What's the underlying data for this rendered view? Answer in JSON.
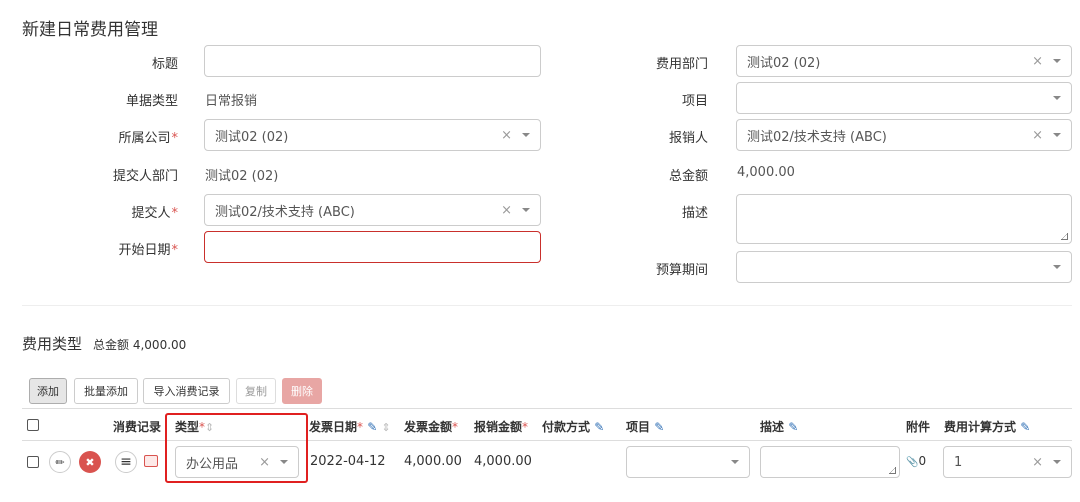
{
  "page": {
    "title": "新建日常费用管理"
  },
  "form": {
    "left": {
      "title_label": "标题",
      "title_value": "",
      "doc_type_label": "单据类型",
      "doc_type_value": "日常报销",
      "company_label": "所属公司",
      "company_value": "测试02 (02)",
      "submitter_dept_label": "提交人部门",
      "submitter_dept_value": "测试02 (02)",
      "submitter_label": "提交人",
      "submitter_value": "测试02/技术支持 (ABC)",
      "start_date_label": "开始日期",
      "start_date_value": ""
    },
    "right": {
      "cost_dept_label": "费用部门",
      "cost_dept_value": "测试02 (02)",
      "project_label": "项目",
      "project_value": "",
      "reimburser_label": "报销人",
      "reimburser_value": "测试02/技术支持 (ABC)",
      "total_label": "总金额",
      "total_value": "4,000.00",
      "description_label": "描述",
      "description_value": "",
      "budget_period_label": "预算期间",
      "budget_period_value": ""
    },
    "required_mark": "*",
    "clear_glyph": "×"
  },
  "expense_section": {
    "title": "费用类型",
    "total_label": "总金额",
    "total_value": "4,000.00",
    "buttons": {
      "add": "添加",
      "batch_add": "批量添加",
      "import": "导入消费记录",
      "copy": "复制",
      "delete": "删除"
    },
    "columns": {
      "records": "消费记录",
      "type": "类型",
      "invoice_date": "发票日期",
      "invoice_amount": "发票金额",
      "reimburse_amount": "报销金额",
      "payment_method": "付款方式",
      "project": "项目",
      "description": "描述",
      "attachment": "附件",
      "calc_method": "费用计算方式"
    },
    "row": {
      "type": "办公用品",
      "invoice_date": "2022-04-12",
      "invoice_amount": "4,000.00",
      "reimburse_amount": "4,000.00",
      "project": "",
      "description": "",
      "attachment_count": "0",
      "calc_method": "1"
    },
    "icons": {
      "edit": "✎",
      "sort": "⇕",
      "pencil": "✏",
      "remove": "✖",
      "menu": "≡",
      "clip": "📎"
    }
  }
}
